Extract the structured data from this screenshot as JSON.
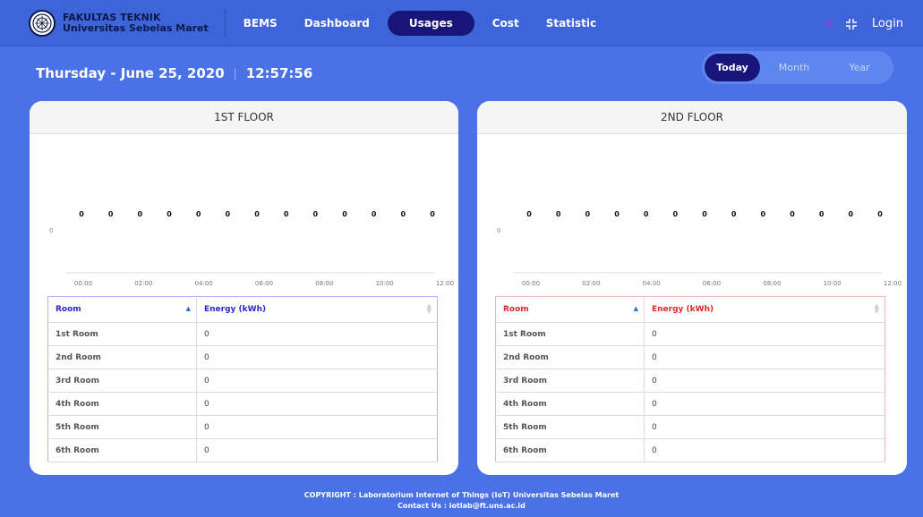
{
  "brand": {
    "line1": "FAKULTAS TEKNIK",
    "line2": "Universitas Sebelas Maret",
    "logo_icon": "university-seal-icon"
  },
  "nav": {
    "items": [
      {
        "label": "BEMS",
        "active": false
      },
      {
        "label": "Dashboard",
        "active": false
      },
      {
        "label": "Usages",
        "active": true
      },
      {
        "label": "Cost",
        "active": false
      },
      {
        "label": "Statistic",
        "active": false
      }
    ],
    "login_label": "Login"
  },
  "header": {
    "date": "Thursday - June 25, 2020",
    "separator": "|",
    "time": "12:57:56"
  },
  "period": {
    "options": [
      "Today",
      "Month",
      "Year"
    ],
    "selected": "Today"
  },
  "panels": [
    {
      "title": "1ST FLOOR",
      "accent": "#2b29c9",
      "table_headers": [
        "Room",
        "Energy (kWh)"
      ],
      "rooms": [
        {
          "room": "1st Room",
          "energy": "0"
        },
        {
          "room": "2nd Room",
          "energy": "0"
        },
        {
          "room": "3rd Room",
          "energy": "0"
        },
        {
          "room": "4th Room",
          "energy": "0"
        },
        {
          "room": "5th Room",
          "energy": "0"
        },
        {
          "room": "6th Room",
          "energy": "0"
        }
      ]
    },
    {
      "title": "2ND FLOOR",
      "accent": "#d92a2a",
      "table_headers": [
        "Room",
        "Energy (kWh)"
      ],
      "rooms": [
        {
          "room": "1st Room",
          "energy": "0"
        },
        {
          "room": "2nd Room",
          "energy": "0"
        },
        {
          "room": "3rd Room",
          "energy": "0"
        },
        {
          "room": "4th Room",
          "energy": "0"
        },
        {
          "room": "5th Room",
          "energy": "0"
        },
        {
          "room": "6th Room",
          "energy": "0"
        }
      ]
    }
  ],
  "chart_data": [
    {
      "type": "bar",
      "title": "",
      "x_ticks": [
        "00:00",
        "02:00",
        "04:00",
        "06:00",
        "08:00",
        "10:00",
        "12:00"
      ],
      "y_ticks": [
        "0"
      ],
      "x": [
        "00:00",
        "01:00",
        "02:00",
        "03:00",
        "04:00",
        "05:00",
        "06:00",
        "07:00",
        "08:00",
        "09:00",
        "10:00",
        "11:00",
        "12:00"
      ],
      "values": [
        0,
        0,
        0,
        0,
        0,
        0,
        0,
        0,
        0,
        0,
        0,
        0,
        0
      ],
      "data_labels": true
    },
    {
      "type": "bar",
      "title": "",
      "x_ticks": [
        "00:00",
        "02:00",
        "04:00",
        "06:00",
        "08:00",
        "10:00",
        "12:00"
      ],
      "y_ticks": [
        "0"
      ],
      "x": [
        "00:00",
        "01:00",
        "02:00",
        "03:00",
        "04:00",
        "05:00",
        "06:00",
        "07:00",
        "08:00",
        "09:00",
        "10:00",
        "11:00",
        "12:00"
      ],
      "values": [
        0,
        0,
        0,
        0,
        0,
        0,
        0,
        0,
        0,
        0,
        0,
        0,
        0
      ],
      "data_labels": true
    }
  ],
  "footer": {
    "copyright": "COPYRIGHT : Laboratorium Internet of Things (IoT) Universitas Sebelas Maret",
    "contact": "Contact Us : iotlab@ft.uns.ac.id"
  }
}
